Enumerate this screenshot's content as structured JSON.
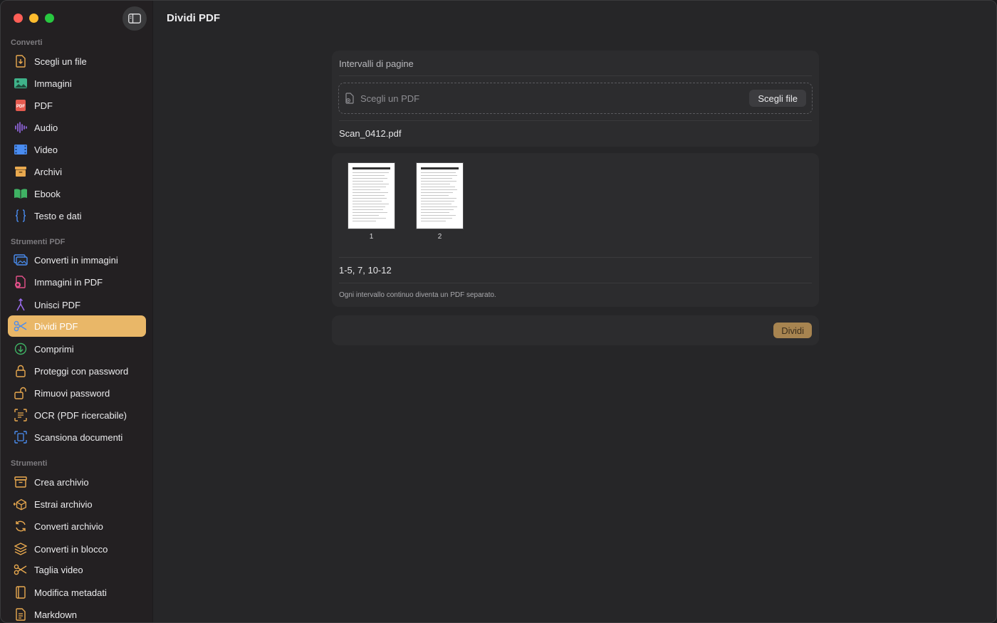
{
  "window": {
    "title": "Dividi PDF"
  },
  "sidebar": {
    "sections": [
      {
        "title": "Converti"
      },
      {
        "title": "Strumenti PDF"
      },
      {
        "title": "Strumenti"
      }
    ],
    "items": [
      {
        "label": "Scegli un file",
        "icon": "file-import-icon",
        "color": "#e9a94f"
      },
      {
        "label": "Immagini",
        "icon": "image-icon",
        "color": "#3fb28a"
      },
      {
        "label": "PDF",
        "icon": "pdf-icon",
        "color": "#e55a4f"
      },
      {
        "label": "Audio",
        "icon": "waveform-icon",
        "color": "#9b6cf0"
      },
      {
        "label": "Video",
        "icon": "film-icon",
        "color": "#4a8cf0"
      },
      {
        "label": "Archivi",
        "icon": "archive-box-icon",
        "color": "#e9a94f"
      },
      {
        "label": "Ebook",
        "icon": "book-icon",
        "color": "#3fb264"
      },
      {
        "label": "Testo e dati",
        "icon": "braces-icon",
        "color": "#4a8cf0"
      },
      {
        "label": "Converti in immagini",
        "icon": "photos-icon",
        "color": "#4a8cf0"
      },
      {
        "label": "Immagini in PDF",
        "icon": "doc-plus-icon",
        "color": "#e5508a"
      },
      {
        "label": "Unisci PDF",
        "icon": "merge-icon",
        "color": "#9b6cf0"
      },
      {
        "label": "Dividi PDF",
        "icon": "scissors-icon",
        "color": "#ffffff"
      },
      {
        "label": "Comprimi",
        "icon": "arrow-down-circle-icon",
        "color": "#3fb264"
      },
      {
        "label": "Proteggi con password",
        "icon": "lock-icon",
        "color": "#e9a94f"
      },
      {
        "label": "Rimuovi password",
        "icon": "unlock-icon",
        "color": "#e9a94f"
      },
      {
        "label": "OCR (PDF ricercabile)",
        "icon": "text-scan-icon",
        "color": "#e9a94f"
      },
      {
        "label": "Scansiona documenti",
        "icon": "doc-scan-icon",
        "color": "#4a8cf0"
      },
      {
        "label": "Crea archivio",
        "icon": "archive-box-icon",
        "color": "#e9a94f"
      },
      {
        "label": "Estrai archivio",
        "icon": "box-open-icon",
        "color": "#e9a94f"
      },
      {
        "label": "Converti archivio",
        "icon": "arrows-cycle-icon",
        "color": "#e9a94f"
      },
      {
        "label": "Converti in blocco",
        "icon": "layers-icon",
        "color": "#e9a94f"
      },
      {
        "label": "Taglia video",
        "icon": "scissors-icon",
        "color": "#e9a94f"
      },
      {
        "label": "Modifica metadati",
        "icon": "book-closed-icon",
        "color": "#e9a94f"
      },
      {
        "label": "Markdown",
        "icon": "doc-text-icon",
        "color": "#e9a94f"
      }
    ],
    "active_item": "Dividi PDF"
  },
  "main": {
    "ranges_card": {
      "header": "Intervalli di pagine",
      "dropzone_placeholder": "Scegli un PDF",
      "choose_button": "Scegli file",
      "filename": "Scan_0412.pdf"
    },
    "preview_card": {
      "pages": [
        {
          "label": "1"
        },
        {
          "label": "2"
        }
      ],
      "ranges_value": "1-5, 7, 10-12",
      "hint": "Ogni intervallo continuo diventa un PDF separato."
    },
    "actions": {
      "split_button": "Dividi"
    }
  },
  "colors": {
    "accent": "#e9b768",
    "background": "#262628",
    "card": "#2c2c2e"
  }
}
